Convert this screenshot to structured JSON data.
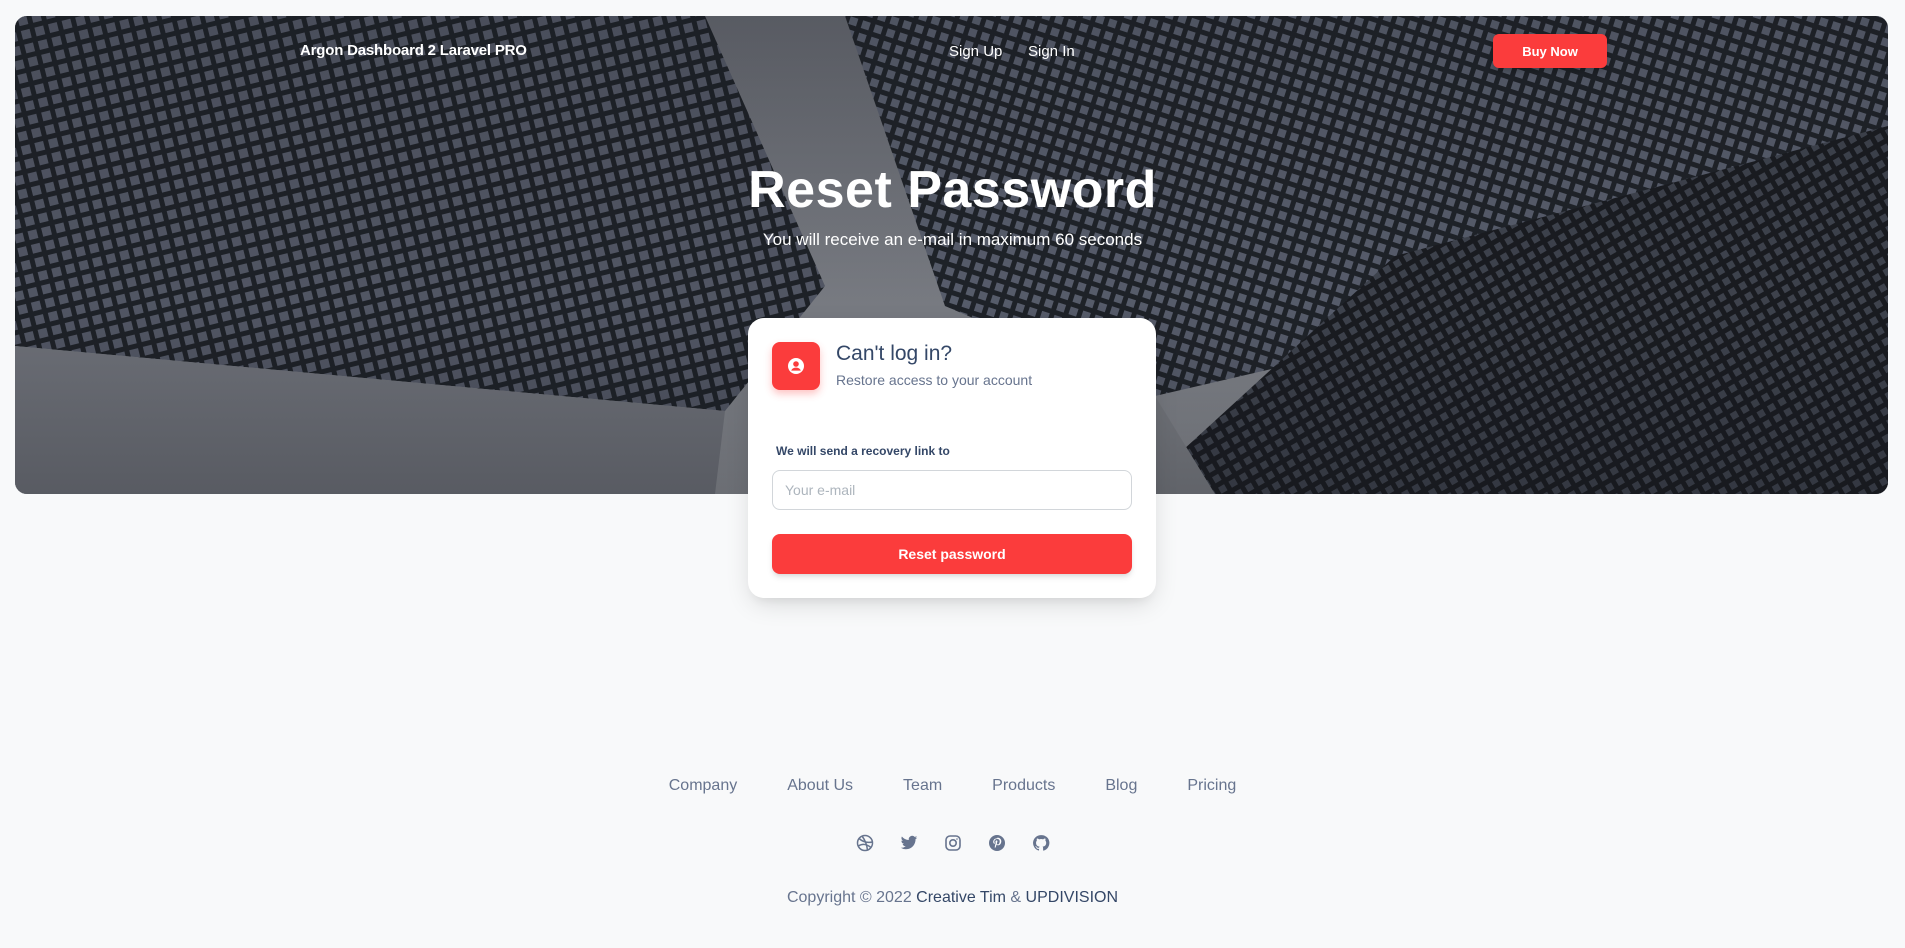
{
  "navbar": {
    "brand": "Argon Dashboard 2 Laravel PRO",
    "links": [
      "Sign Up",
      "Sign In"
    ],
    "buy_label": "Buy Now"
  },
  "hero": {
    "title": "Reset Password",
    "subtitle": "You will receive an e-mail in maximum 60 seconds"
  },
  "card": {
    "icon": "user-circle-icon",
    "title": "Can't log in?",
    "subtitle": "Restore access to your account",
    "field_label": "We will send a recovery link to",
    "email_placeholder": "Your e-mail",
    "email_value": "",
    "submit_label": "Reset password"
  },
  "footer": {
    "links": [
      "Company",
      "About Us",
      "Team",
      "Products",
      "Blog",
      "Pricing"
    ],
    "social_icons": [
      "dribbble-icon",
      "twitter-icon",
      "instagram-icon",
      "pinterest-icon",
      "github-icon"
    ],
    "copyright_prefix": "Copyright © 2022",
    "author_1": "Creative Tim",
    "separator": "&",
    "author_2": "UPDIVISION"
  },
  "colors": {
    "accent": "#fb3c3c",
    "text_dark": "#344767",
    "text_muted": "#67748e",
    "background": "#f8f9fa"
  }
}
